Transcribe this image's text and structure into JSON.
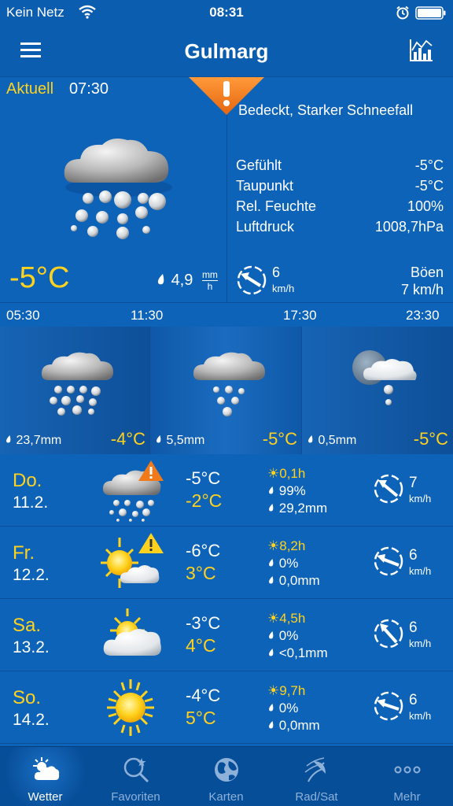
{
  "status_bar": {
    "carrier": "Kein Netz",
    "time": "08:31"
  },
  "nav": {
    "title": "Gulmarg"
  },
  "current": {
    "label": "Aktuell",
    "time": "07:30",
    "condition": "Bedeckt, Starker Schneefall",
    "temperature": "-5°C",
    "precip_value": "4,9",
    "precip_unit_top": "mm",
    "precip_unit_bottom": "h",
    "details": [
      {
        "label": "Gefühlt",
        "value": "-5°C"
      },
      {
        "label": "Taupunkt",
        "value": "-5°C"
      },
      {
        "label": "Rel. Feuchte",
        "value": "100%"
      },
      {
        "label": "Luftdruck",
        "value": "1008,7hPa"
      }
    ],
    "wind_speed": "6",
    "wind_unit": "km/h",
    "gust_label": "Böen",
    "gust_value": "7 km/h",
    "icons": {
      "weather": "cloud-heavy-snow-icon",
      "warning": "warning-exclamation-icon"
    }
  },
  "hourly": [
    {
      "time": "05:30",
      "precip": "23,7mm",
      "temp": "-4°C",
      "icon": "cloud-heavy-snow-icon"
    },
    {
      "time": "11:30",
      "precip": "5,5mm",
      "temp": "-5°C",
      "icon": "cloud-snow-icon"
    },
    {
      "time": "17:30",
      "precip": "0,5mm",
      "temp": "-5°C",
      "icon": "moon-cloud-light-snow-icon"
    },
    {
      "time": "23:30",
      "precip": "0,5mm",
      "temp": "-5°C",
      "icon": "moon-cloud-light-snow-icon"
    }
  ],
  "daily": [
    {
      "day": "Do.",
      "date": "11.2.",
      "tmin": "-5°C",
      "tmax": "-2°C",
      "sun": "0,1h",
      "humidity": "99%",
      "precip": "29,2mm",
      "wind": "7",
      "wind_unit": "km/h",
      "icon": "cloud-snow-warning-icon"
    },
    {
      "day": "Fr.",
      "date": "12.2.",
      "tmin": "-6°C",
      "tmax": "3°C",
      "sun": "8,2h",
      "humidity": "0%",
      "precip": "0,0mm",
      "wind": "6",
      "wind_unit": "km/h",
      "icon": "sun-cloud-warning-icon"
    },
    {
      "day": "Sa.",
      "date": "13.2.",
      "tmin": "-3°C",
      "tmax": "4°C",
      "sun": "4,5h",
      "humidity": "0%",
      "precip": "<0,1mm",
      "wind": "6",
      "wind_unit": "km/h",
      "icon": "sun-behind-cloud-icon"
    },
    {
      "day": "So.",
      "date": "14.2.",
      "tmin": "-4°C",
      "tmax": "5°C",
      "sun": "9,7h",
      "humidity": "0%",
      "precip": "0,0mm",
      "wind": "6",
      "wind_unit": "km/h",
      "icon": "sun-icon"
    }
  ],
  "tabs": [
    {
      "label": "Wetter",
      "icon": "weather-tab-icon",
      "active": true
    },
    {
      "label": "Favoriten",
      "icon": "favorites-search-icon",
      "active": false
    },
    {
      "label": "Karten",
      "icon": "globe-icon",
      "active": false
    },
    {
      "label": "Rad/Sat",
      "icon": "radar-satellite-icon",
      "active": false
    },
    {
      "label": "Mehr",
      "icon": "more-dots-icon",
      "active": false
    }
  ],
  "colors": {
    "background": "#0d63b8",
    "accent_yellow": "#ffd21e",
    "warning_orange": "#f07a1a",
    "tabbar": "#074e99"
  }
}
